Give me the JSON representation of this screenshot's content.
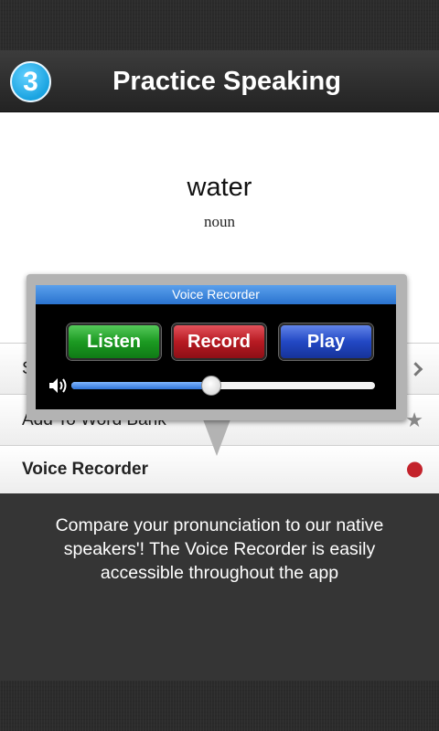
{
  "header": {
    "step_number": "3",
    "title": "Practice Speaking"
  },
  "word": {
    "text": "water",
    "part_of_speech": "noun"
  },
  "menu": [
    {
      "label": "Sa",
      "icon": "chevron-right-icon"
    },
    {
      "label": "Add To Word Bank",
      "icon": "star-icon"
    },
    {
      "label": "Voice Recorder",
      "icon": "red-dot-icon"
    }
  ],
  "popup": {
    "title": "Voice Recorder",
    "buttons": {
      "listen": "Listen",
      "record": "Record",
      "play": "Play"
    },
    "volume_level": 0.46
  },
  "info": {
    "text": "Compare your pronunciation to our native speakers'! The Voice Recorder is easily accessible throughout the app"
  },
  "colors": {
    "badge": "#1aa3e0",
    "listen": "#1c9a22",
    "record": "#b71a22",
    "play": "#2248c4",
    "titlebar": "#2a73cf",
    "record_dot": "#c3222b"
  }
}
